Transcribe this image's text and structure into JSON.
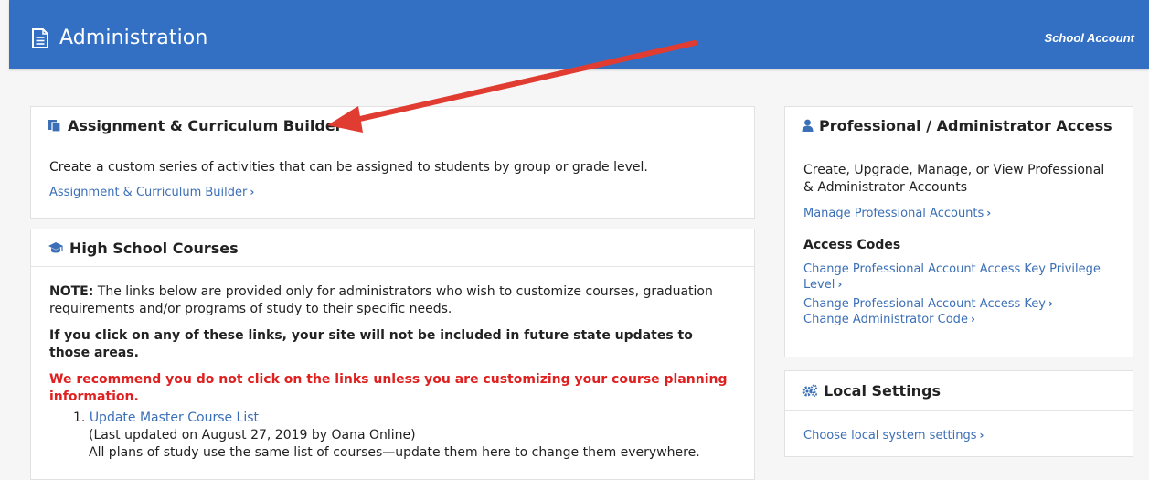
{
  "header": {
    "title": "Administration",
    "account_label": "School Account"
  },
  "assignment_panel": {
    "title": "Assignment & Curriculum Builder",
    "description": "Create a custom series of activities that can be assigned to students by group or grade level.",
    "link": "Assignment & Curriculum Builder"
  },
  "courses_panel": {
    "title": "High School Courses",
    "note_label": "NOTE:",
    "note_text": " The links below are provided only for administrators who wish to customize courses, graduation requirements and/or programs of study to their specific needs.",
    "warning": "If you click on any of these links, your site will not be included in future state updates to those areas.",
    "recommend": "We recommend you do not click on the links unless you are customizing your course planning information.",
    "items": [
      {
        "number": "1.",
        "link": "Update Master Course List",
        "updated": "(Last updated on August 27, 2019 by Oana Online)",
        "desc": "All plans of study use the same list of courses—update them here to change them everywhere."
      }
    ]
  },
  "professional_panel": {
    "title": "Professional / Administrator Access",
    "description": "Create, Upgrade, Manage, or View Professional & Administrator Accounts",
    "manage_link": "Manage Professional Accounts",
    "access_codes_heading": "Access Codes",
    "links": [
      "Change Professional Account Access Key Privilege Level",
      "Change Professional Account Access Key",
      "Change Administrator Code"
    ]
  },
  "local_panel": {
    "title": "Local Settings",
    "link": "Choose local system settings"
  },
  "colors": {
    "header_bg": "#3370c4",
    "link": "#3b6fb6",
    "warning_red": "#e02020",
    "annotation_arrow": "#e03c31"
  }
}
